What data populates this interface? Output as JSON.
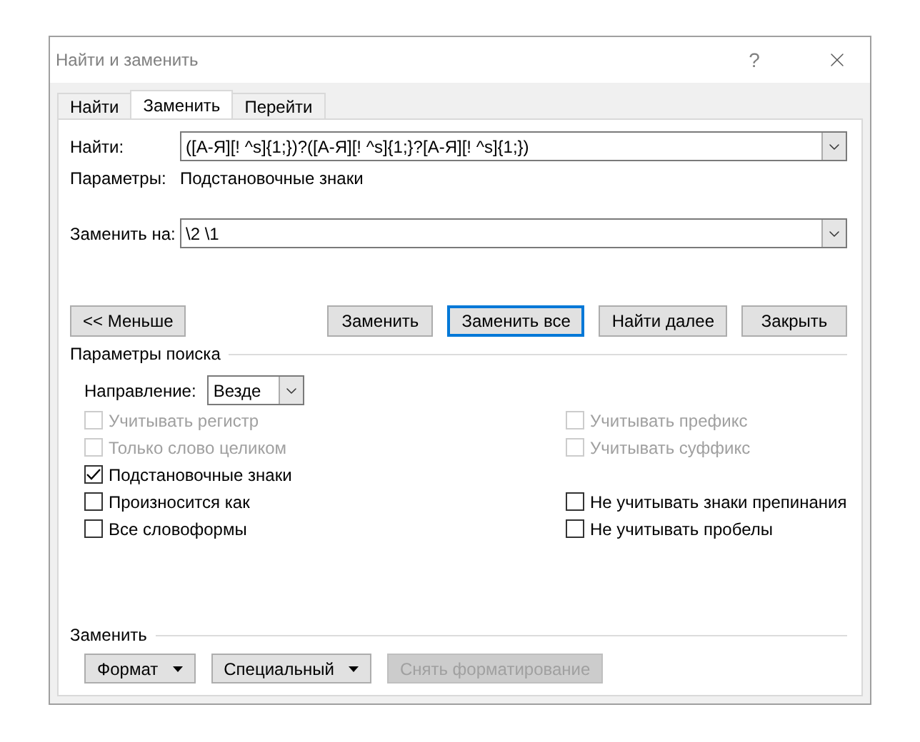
{
  "window": {
    "title": "Найти и заменить",
    "help": "?"
  },
  "tabs": [
    {
      "label": "Найти",
      "selected": false
    },
    {
      "label": "Заменить",
      "selected": true
    },
    {
      "label": "Перейти",
      "selected": false
    }
  ],
  "find": {
    "label": "Найти:",
    "value": "([А-Я][! ^s]{1;})?([А-Я][! ^s]{1;}?[А-Я][! ^s]{1;})",
    "options_label": "Параметры:",
    "options_value": "Подстановочные знаки"
  },
  "replace": {
    "label": "Заменить на:",
    "value": "\\2 \\1"
  },
  "less_button": "<< Меньше",
  "action_buttons": [
    {
      "label": "Заменить",
      "default": false
    },
    {
      "label": "Заменить все",
      "default": true
    },
    {
      "label": "Найти далее",
      "default": false
    },
    {
      "label": "Закрыть",
      "default": false
    }
  ],
  "search_options": {
    "title": "Параметры поиска",
    "direction_label": "Направление:",
    "direction_value": "Везде",
    "rows": [
      {
        "left": {
          "label": "Учитывать регистр",
          "checked": false,
          "disabled": true
        },
        "right": {
          "label": "Учитывать префикс",
          "checked": false,
          "disabled": true
        }
      },
      {
        "left": {
          "label": "Только слово целиком",
          "checked": false,
          "disabled": true
        },
        "right": {
          "label": "Учитывать суффикс",
          "checked": false,
          "disabled": true
        }
      },
      {
        "left": {
          "label": "Подстановочные знаки",
          "checked": true,
          "disabled": false
        }
      },
      {
        "left": {
          "label": "Произносится как",
          "checked": false,
          "disabled": false
        },
        "right": {
          "label": "Не учитывать знаки препинания",
          "checked": false,
          "disabled": false
        }
      },
      {
        "left": {
          "label": "Все словоформы",
          "checked": false,
          "disabled": false
        },
        "right": {
          "label": "Не учитывать пробелы",
          "checked": false,
          "disabled": false
        }
      }
    ]
  },
  "replace_section": {
    "title": "Заменить",
    "buttons": [
      {
        "label": "Формат",
        "dropdown": true,
        "disabled": false
      },
      {
        "label": "Специальный",
        "dropdown": true,
        "disabled": false
      },
      {
        "label": "Снять форматирование",
        "dropdown": false,
        "disabled": true
      }
    ]
  }
}
